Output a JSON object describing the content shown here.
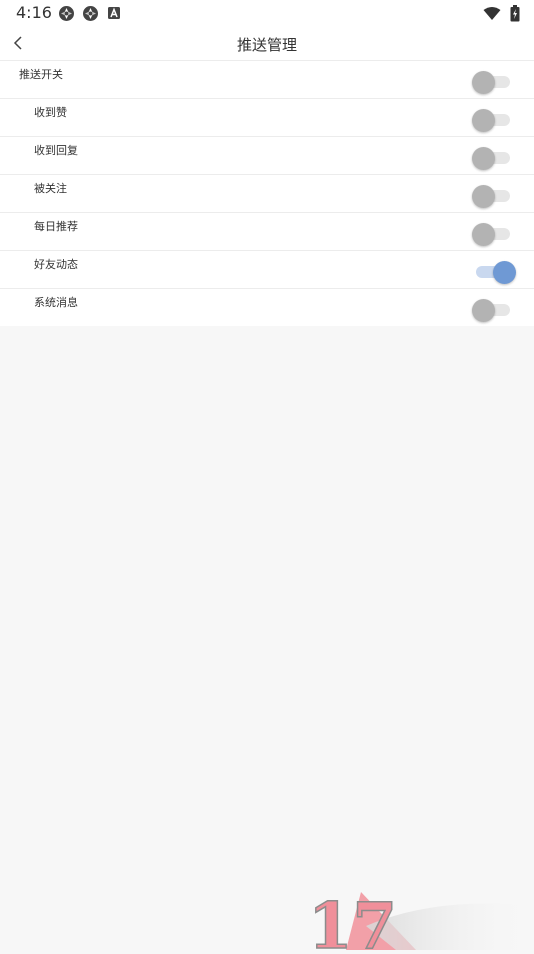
{
  "status_bar": {
    "time": "4:16",
    "left_icons": [
      "aperture-icon",
      "aperture-icon",
      "a-box-icon"
    ],
    "right_icons": [
      "wifi-icon",
      "battery-charging-icon"
    ]
  },
  "header": {
    "title": "推送管理",
    "back_icon": "chevron-left-icon"
  },
  "settings": {
    "items": [
      {
        "label": "推送开关",
        "enabled": false,
        "level": "master"
      },
      {
        "label": "收到赞",
        "enabled": false,
        "level": "sub"
      },
      {
        "label": "收到回复",
        "enabled": false,
        "level": "sub"
      },
      {
        "label": "被关注",
        "enabled": false,
        "level": "sub"
      },
      {
        "label": "每日推荐",
        "enabled": false,
        "level": "sub"
      },
      {
        "label": "好友动态",
        "enabled": true,
        "level": "sub"
      },
      {
        "label": "系统消息",
        "enabled": false,
        "level": "sub"
      }
    ]
  },
  "colors": {
    "toggle_on_thumb": "#6f99d4",
    "toggle_on_track": "#c9d8ef",
    "toggle_off_thumb": "#b3b3b3",
    "toggle_off_track": "#e6e6e6",
    "page_background": "#f7f7f7"
  },
  "watermark": {
    "text": "17"
  }
}
